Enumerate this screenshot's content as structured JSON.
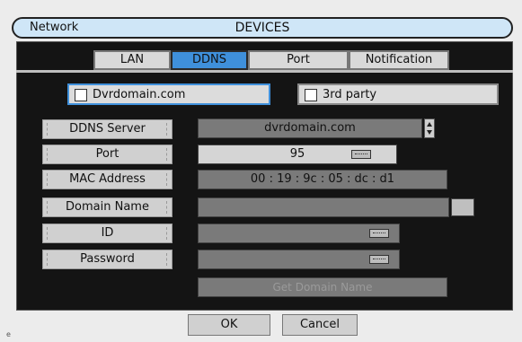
{
  "window": {
    "title_left": "Network",
    "title_center": "DEVICES"
  },
  "tabs": [
    {
      "label": "LAN"
    },
    {
      "label": "DDNS",
      "active": true
    },
    {
      "label": "Port"
    },
    {
      "label": "Notification"
    }
  ],
  "providers": {
    "dvrdomain": {
      "label": "Dvrdomain.com",
      "checked": false,
      "selected": true
    },
    "third_party": {
      "label": "3rd party",
      "checked": false
    }
  },
  "fields": {
    "ddns_server": {
      "label": "DDNS Server",
      "value": "dvrdomain.com"
    },
    "port": {
      "label": "Port",
      "value": "95"
    },
    "mac_address": {
      "label": "MAC Address",
      "value": "00 : 19 : 9c : 05 : dc : d1"
    },
    "domain_name": {
      "label": "Domain Name",
      "value": ""
    },
    "id": {
      "label": "ID",
      "value": ""
    },
    "password": {
      "label": "Password",
      "value": ""
    }
  },
  "buttons": {
    "get_domain": "Get Domain Name",
    "ok": "OK",
    "cancel": "Cancel"
  },
  "footer": {
    "corner": "e"
  },
  "colors": {
    "active_tab": "#3f90db",
    "panel_bg": "#141414",
    "titlebar_bg": "#cfe6f7"
  },
  "icons": [
    "keyboard-icon",
    "spinner-arrows-icon",
    "checkbox-icon"
  ]
}
